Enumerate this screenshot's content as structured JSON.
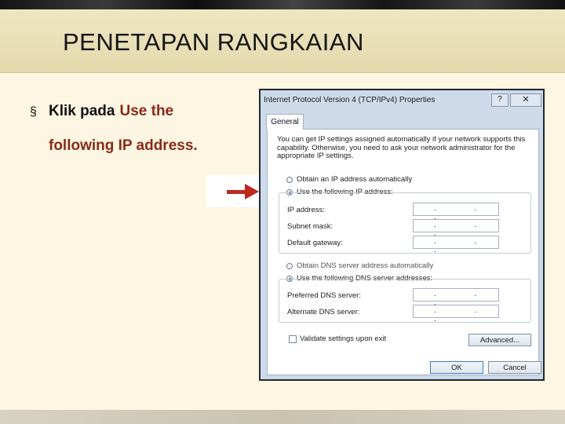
{
  "slide": {
    "title": "PENETAPAN RANGKAIAN",
    "bullet_symbol": "§",
    "bullet_prefix": "Klik pada",
    "bullet_emphasis_1": "Use the",
    "bullet_emphasis_2": "following IP address."
  },
  "dialog": {
    "title": "Internet Protocol Version 4 (TCP/IPv4) Properties",
    "help_label": "?",
    "close_label": "✕",
    "tab_label": "General",
    "description": "You can get IP settings assigned automatically if your network supports this capability. Otherwise, you need to ask your network administrator for the appropriate IP settings.",
    "ip_auto_label": "Obtain an IP address automatically",
    "ip_manual_label": "Use the following IP address:",
    "ip_address_label": "IP address:",
    "subnet_label": "Subnet mask:",
    "gateway_label": "Default gateway:",
    "dns_auto_label": "Obtain DNS server address automatically",
    "dns_manual_label": "Use the following DNS server addresses:",
    "preferred_dns_label": "Preferred DNS server:",
    "alternate_dns_label": "Alternate DNS server:",
    "field_value": ". . .",
    "validate_label": "Validate settings upon exit",
    "advanced_label": "Advanced...",
    "ok_label": "OK",
    "cancel_label": "Cancel",
    "ip_mode": "manual",
    "dns_mode": "manual",
    "validate_checked": false
  },
  "colors": {
    "accent_text": "#8a2a18",
    "arrow": "#c0281e",
    "dialog_chrome": "#cddaea"
  },
  "icons": {
    "pointer": "red-right-arrow"
  }
}
